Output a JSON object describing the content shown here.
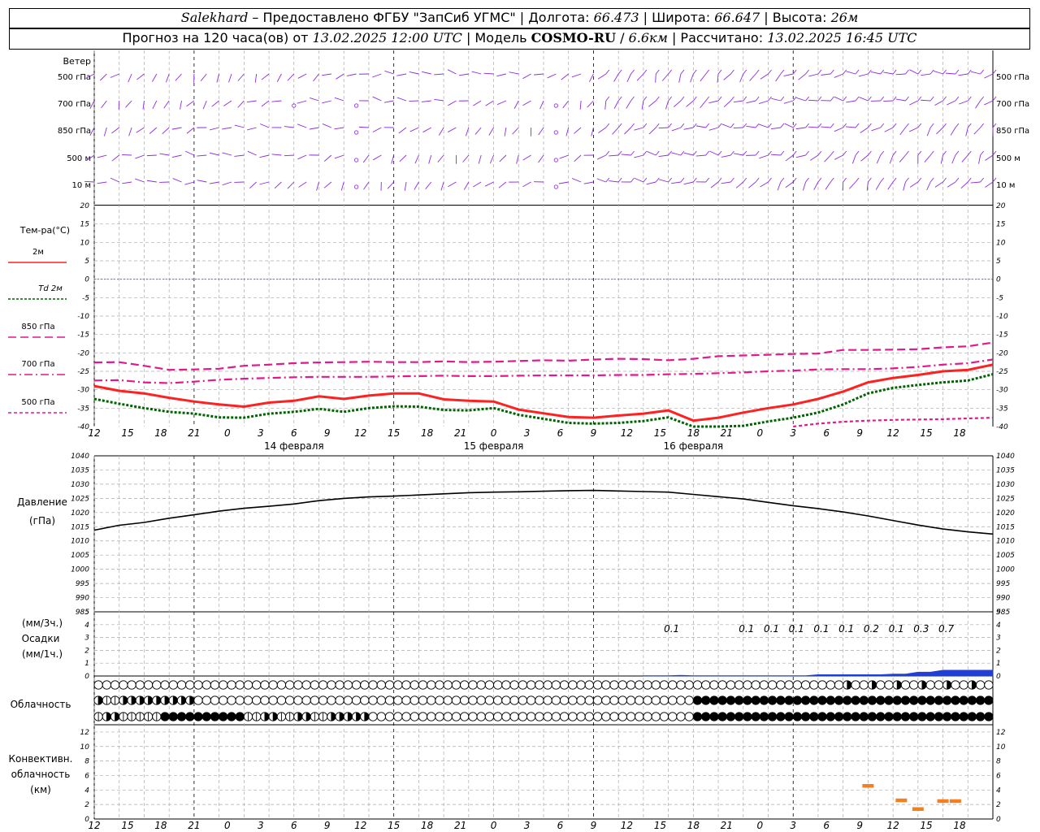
{
  "header": {
    "station": "Salekhard",
    "provider": "Предоставлено ФГБУ \"ЗапСиб УГМС\"",
    "lon_label": "Долгота:",
    "lon_value": "66.473",
    "lat_label": "Широта:",
    "lat_value": "66.647",
    "alt_label": "Высота:",
    "alt_value": "26м",
    "forecast_label": "Прогноз на 120 часа(ов) от",
    "forecast_start": "13.02.2025 12:00 UTC",
    "model_label": "Модель",
    "model_name": "COSMO-RU",
    "model_res": "6.6км",
    "computed_label": "Рассчитано:",
    "computed_time": "13.02.2025 16:45 UTC"
  },
  "wind_panel": {
    "title": "Ветер",
    "levels": [
      "500 гПа",
      "700 гПа",
      "850 гПа",
      "500 м",
      "10 м"
    ]
  },
  "temperature_panel": {
    "title": "Тем-ра(°C)",
    "legend": [
      {
        "label": "2м",
        "color": "#ff2020",
        "style": "solid"
      },
      {
        "label": "Td 2м",
        "color": "#006400",
        "style": "dotted"
      },
      {
        "label": "850 гПа",
        "color": "#e0198c",
        "style": "long-dash"
      },
      {
        "label": "700 гПа",
        "color": "#e0198c",
        "style": "dash-dot"
      },
      {
        "label": "500 гПа",
        "color": "#e0198c",
        "style": "short-dash"
      }
    ],
    "ylim": [
      -40,
      20
    ],
    "ticks": [
      "20",
      "15",
      "10",
      "5",
      "0",
      "-5",
      "-10",
      "-15",
      "-20",
      "-25",
      "-30",
      "-35",
      "-40"
    ]
  },
  "pressure_panel": {
    "title": "Давление",
    "unit": "(гПа)",
    "ylim": [
      985,
      1040
    ],
    "ticks": [
      "1040",
      "1035",
      "1030",
      "1025",
      "1020",
      "1015",
      "1010",
      "1005",
      "1000",
      "995",
      "990",
      "985"
    ]
  },
  "precip_panel": {
    "unit_3h": "(мм/3ч.)",
    "title": "Осадки",
    "unit_1h": "(мм/1ч.)",
    "ticks": [
      "5",
      "4",
      "3",
      "2",
      "1",
      "0"
    ],
    "labels": [
      {
        "hour": 69,
        "text": "0.1"
      },
      {
        "hour": 78,
        "text": "0.1"
      },
      {
        "hour": 81,
        "text": "0.1"
      },
      {
        "hour": 84,
        "text": "0.1"
      },
      {
        "hour": 87,
        "text": "0.1"
      },
      {
        "hour": 90,
        "text": "0.1"
      },
      {
        "hour": 93,
        "text": "0.2"
      },
      {
        "hour": 96,
        "text": "0.1"
      },
      {
        "hour": 99,
        "text": "0.3"
      },
      {
        "hour": 102,
        "text": "0.7"
      }
    ]
  },
  "cloud_panel": {
    "title": "Облачность"
  },
  "convective_panel": {
    "title_1": "Конвективн.",
    "title_2": "облачность",
    "unit": "(км)",
    "ticks": [
      "12",
      "10",
      "8",
      "6",
      "4",
      "2",
      "0"
    ]
  },
  "time_axis": {
    "hour_labels": [
      "12",
      "15",
      "18",
      "21",
      "0",
      "3",
      "6",
      "9",
      "12",
      "15",
      "18",
      "21",
      "0",
      "3",
      "6",
      "9",
      "12",
      "15",
      "18",
      "21",
      "0",
      "3",
      "6",
      "9",
      "12",
      "15",
      "18"
    ],
    "day_labels": [
      {
        "hour": 24,
        "text": "14 февраля"
      },
      {
        "hour": 48,
        "text": "15 февраля"
      },
      {
        "hour": 72,
        "text": "16 февраля"
      }
    ]
  },
  "chart_data": {
    "type": "line",
    "x_unit": "hours from 13.02.2025 12:00 UTC",
    "x": [
      0,
      3,
      6,
      9,
      12,
      15,
      18,
      21,
      24,
      27,
      30,
      33,
      36,
      39,
      42,
      45,
      48,
      51,
      54,
      57,
      60,
      63,
      66,
      69,
      72,
      75,
      78,
      81,
      84,
      87,
      90,
      93,
      96,
      99,
      102,
      105,
      108
    ],
    "series": [
      {
        "name": "2м",
        "unit": "°C",
        "values": [
          -29,
          -30.3,
          -31,
          -32.2,
          -33.2,
          -34,
          -34.6,
          -33.5,
          -33,
          -31.8,
          -32.5,
          -31.6,
          -31,
          -31,
          -32.6,
          -33,
          -33.2,
          -35.4,
          -36.4,
          -37.4,
          -37.6,
          -37,
          -36.5,
          -35.6,
          -38.4,
          -37.6,
          -36.2,
          -35,
          -34,
          -32.5,
          -30.5,
          -28,
          -26.8,
          -26,
          -25,
          -24.6,
          -23.2
        ]
      },
      {
        "name": "Td 2м",
        "unit": "°C",
        "values": [
          -32.5,
          -33.8,
          -35,
          -36,
          -36.5,
          -37.5,
          -37.6,
          -36.5,
          -36,
          -35.2,
          -36,
          -35,
          -34.5,
          -34.6,
          -35.5,
          -35.6,
          -35,
          -36.8,
          -37.9,
          -39,
          -39.2,
          -39,
          -38.5,
          -37.5,
          -40,
          -40,
          -39.8,
          -38.6,
          -37.6,
          -36.2,
          -34,
          -31,
          -29.5,
          -28.7,
          -28,
          -27.5,
          -25.8
        ]
      },
      {
        "name": "850 гПа",
        "unit": "°C",
        "values": [
          -22.6,
          -22.5,
          -23.5,
          -24.6,
          -24.5,
          -24.3,
          -23.5,
          -23.2,
          -22.8,
          -22.6,
          -22.5,
          -22.4,
          -22.5,
          -22.5,
          -22.3,
          -22.5,
          -22.4,
          -22.2,
          -22,
          -22.1,
          -21.8,
          -21.6,
          -21.7,
          -22,
          -21.6,
          -20.9,
          -20.7,
          -20.5,
          -20.3,
          -20.2,
          -19.2,
          -19.2,
          -19.1,
          -19,
          -18.5,
          -18.2,
          -17.2
        ]
      },
      {
        "name": "700 гПа",
        "unit": "°C",
        "values": [
          -27.5,
          -27.4,
          -28,
          -28.2,
          -27.8,
          -27.3,
          -27,
          -26.8,
          -26.6,
          -26.5,
          -26.5,
          -26.5,
          -26.4,
          -26.3,
          -26.2,
          -26.3,
          -26.3,
          -26.2,
          -26.1,
          -26.1,
          -26.1,
          -26,
          -26,
          -25.8,
          -25.7,
          -25.5,
          -25.3,
          -25,
          -24.8,
          -24.5,
          -24.4,
          -24.4,
          -24.2,
          -23.8,
          -23.2,
          -22.8,
          -21.8
        ]
      },
      {
        "name": "500 гПа",
        "unit": "°C",
        "values": [
          null,
          null,
          null,
          null,
          null,
          null,
          null,
          null,
          null,
          null,
          null,
          null,
          null,
          null,
          null,
          null,
          null,
          null,
          null,
          null,
          null,
          null,
          null,
          null,
          null,
          null,
          null,
          null,
          -40,
          -39.2,
          -38.7,
          -38.4,
          -38.2,
          -38.1,
          -38,
          -37.8,
          -37.6
        ]
      }
    ],
    "pressure": {
      "name": "Давление",
      "unit": "гПа",
      "values": [
        1013.8,
        1015.5,
        1016.5,
        1018,
        1019.2,
        1020.5,
        1021.5,
        1022.2,
        1023,
        1024.2,
        1025,
        1025.5,
        1025.8,
        1026.2,
        1026.6,
        1027,
        1027.2,
        1027.3,
        1027.5,
        1027.7,
        1027.8,
        1027.6,
        1027.4,
        1027.2,
        1026.4,
        1025.6,
        1024.8,
        1023.6,
        1022.4,
        1021.4,
        1020.2,
        1018.8,
        1017.2,
        1015.6,
        1014.2,
        1013.2,
        1012.4
      ]
    },
    "precipitation": {
      "unit": "мм/1ч.",
      "hours": [
        69,
        78,
        81,
        84,
        87,
        90,
        93,
        96,
        99,
        102
      ],
      "values": [
        0.03,
        0.03,
        0.03,
        0.03,
        0.03,
        0.03,
        0.07,
        0.03,
        0.1,
        0.23
      ]
    },
    "convective_cloud": {
      "unit": "км",
      "bars": [
        {
          "hour": 97,
          "value": 2.6
        },
        {
          "hour": 93,
          "value": 4.6
        },
        {
          "hour": 99,
          "value": 1.4
        },
        {
          "hour": 102,
          "value": 2.5
        },
        {
          "hour": 103.5,
          "value": 2.5
        }
      ]
    },
    "wind_levels": [
      "500 гПа",
      "700 гПа",
      "850 гПа",
      "500 м",
      "10 м"
    ],
    "cloud_cover_rows": 3,
    "cloud_cover_octas": [
      [
        0,
        0,
        0,
        0,
        0,
        0,
        0,
        0,
        0,
        0,
        0,
        0,
        0,
        0,
        0,
        0,
        0,
        0,
        0,
        0,
        0,
        0,
        0,
        0,
        0,
        0,
        0,
        0,
        0,
        0,
        0,
        0,
        0,
        0,
        0,
        0,
        0,
        0,
        0,
        0,
        0,
        0,
        0,
        0,
        0,
        0,
        0,
        0,
        0,
        0,
        0,
        0,
        0,
        0,
        0,
        0,
        0,
        0,
        0,
        0,
        0,
        0,
        0,
        0,
        0,
        0,
        0,
        0,
        0,
        0,
        0,
        0,
        0,
        0,
        0,
        0,
        0,
        0,
        0,
        0,
        0,
        0,
        0,
        0,
        0,
        0,
        0,
        0,
        0,
        0,
        0,
        0,
        0,
        0,
        0,
        0,
        0,
        0,
        0,
        0,
        0,
        0,
        0,
        0,
        0,
        0,
        0,
        0
      ],
      [
        6,
        2,
        2,
        4,
        4,
        4,
        4,
        4,
        4,
        4,
        4,
        4,
        0,
        0,
        0,
        0,
        0,
        0,
        0,
        0,
        0,
        0,
        0,
        0,
        0,
        0,
        0,
        0,
        0,
        0,
        0,
        0,
        0,
        0,
        0,
        0,
        0,
        0,
        0,
        0,
        0,
        0,
        0,
        0,
        0,
        0,
        0,
        0,
        0,
        0,
        0,
        0,
        0,
        0,
        0,
        0,
        0,
        0,
        0,
        0,
        0,
        0,
        0,
        0,
        0,
        0,
        0,
        0,
        0,
        0,
        0,
        0,
        0,
        0,
        0,
        0,
        0,
        0,
        0,
        0,
        0,
        0,
        0,
        0,
        0,
        0,
        0,
        0,
        0,
        0,
        0,
        0,
        0,
        0,
        0,
        0,
        0,
        0,
        0,
        0,
        0,
        0,
        0,
        0,
        0,
        0,
        0,
        0
      ],
      [
        2,
        4,
        4,
        2,
        2,
        2,
        2,
        2,
        8,
        8,
        8,
        8,
        8,
        8,
        8,
        8,
        8,
        8,
        2,
        2,
        4,
        4,
        2,
        2,
        4,
        4,
        2,
        2,
        4,
        4,
        4,
        4,
        4,
        0,
        0,
        0,
        0,
        0,
        0,
        0,
        0,
        0,
        0,
        0,
        0,
        0,
        0,
        0,
        0,
        0,
        0,
        0,
        0,
        0,
        0,
        0,
        0,
        0,
        0,
        0,
        0,
        0,
        0,
        0,
        0,
        0,
        0,
        0,
        0,
        0,
        0,
        0,
        0,
        0,
        0,
        0,
        0,
        0,
        0,
        0,
        0,
        0,
        0,
        0,
        0,
        0,
        0,
        0,
        0,
        0,
        0,
        0,
        0,
        0,
        0,
        0,
        0,
        0,
        0,
        0,
        0,
        0,
        0,
        0,
        0,
        0,
        0,
        0
      ]
    ]
  }
}
